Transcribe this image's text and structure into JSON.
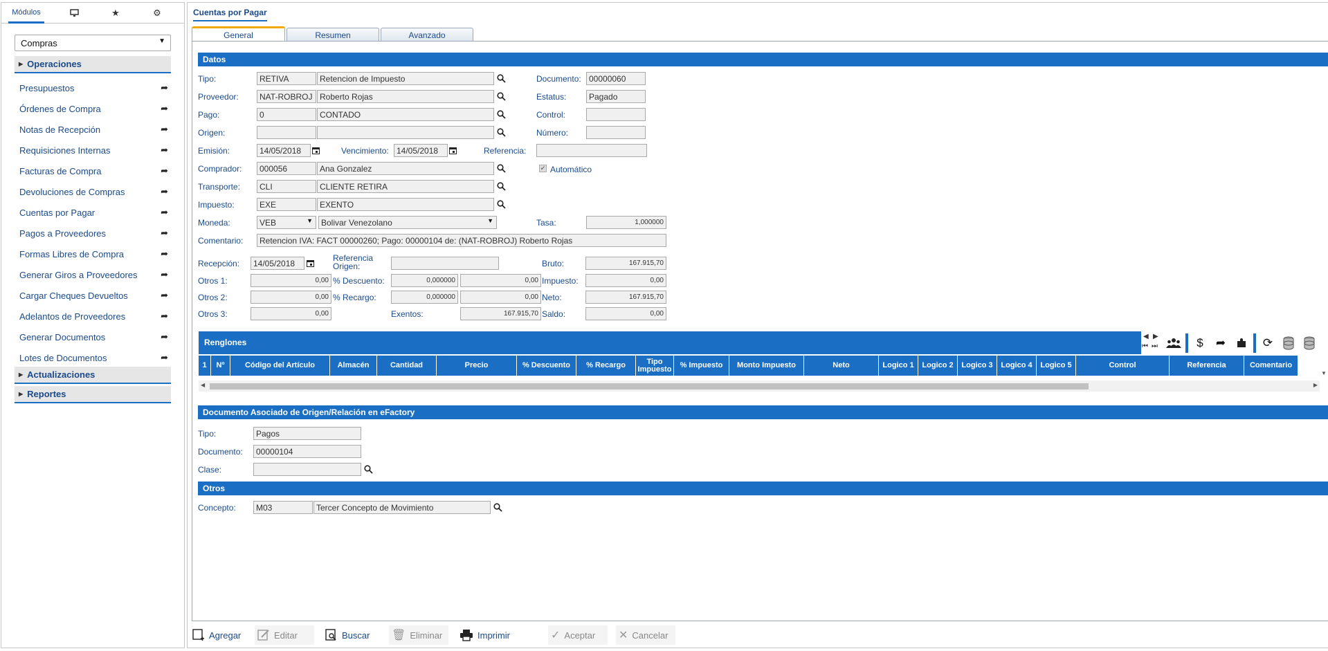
{
  "left_panel": {
    "tabs": {
      "modules_label": "Módulos"
    },
    "module_select": "Compras",
    "groups": {
      "operaciones": "Operaciones",
      "actualizaciones": "Actualizaciones",
      "reportes": "Reportes"
    },
    "items": [
      "Presupuestos",
      "Órdenes de Compra",
      "Notas de Recepción",
      "Requisiciones Internas",
      "Facturas de Compra",
      "Devoluciones de Compras",
      "Cuentas por Pagar",
      "Pagos a Proveedores",
      "Formas Libres de Compra",
      "Generar Giros a Proveedores",
      "Cargar Cheques Devueltos",
      "Adelantos de Proveedores",
      "Generar Documentos",
      "Lotes de Documentos"
    ]
  },
  "main": {
    "title": "Cuentas por Pagar",
    "tabs": [
      "General",
      "Resumen",
      "Avanzado"
    ],
    "sections": {
      "datos": "Datos",
      "renglones": "Renglones",
      "doc_asociado": "Documento Asociado de Origen/Relación en eFactory",
      "otros": "Otros"
    },
    "labels": {
      "tipo": "Tipo:",
      "proveedor": "Proveedor:",
      "pago": "Pago:",
      "origen": "Origen:",
      "emision": "Emisión:",
      "vencimiento": "Vencimiento:",
      "referencia": "Referencia:",
      "comprador": "Comprador:",
      "transporte": "Transporte:",
      "impuesto": "Impuesto:",
      "moneda": "Moneda:",
      "tasa": "Tasa:",
      "comentario": "Comentario:",
      "documento": "Documento:",
      "estatus": "Estatus:",
      "control": "Control:",
      "numero": "Número:",
      "automatico": "Automático",
      "recepcion": "Recepción:",
      "referencia_origen": "Referencia Origen:",
      "otros1": "Otros 1:",
      "otros2": "Otros 2:",
      "otros3": "Otros 3:",
      "descuento": "% Descuento:",
      "recargo": "% Recargo:",
      "exentos": "Exentos:",
      "bruto": "Bruto:",
      "impuesto_r": "Impuesto:",
      "neto": "Neto:",
      "saldo": "Saldo:",
      "clase": "Clase:",
      "concepto": "Concepto:"
    },
    "values": {
      "tipo_code": "RETIVA",
      "tipo_desc": "Retencion de Impuesto",
      "proveedor_code": "NAT-ROBROJ",
      "proveedor_desc": "Roberto Rojas",
      "pago_code": "0",
      "pago_desc": "CONTADO",
      "origen_code": "",
      "origen_desc": "",
      "emision": "14/05/2018",
      "vencimiento": "14/05/2018",
      "referencia": "",
      "comprador_code": "000056",
      "comprador_desc": "Ana Gonzalez",
      "transporte_code": "CLI",
      "transporte_desc": "CLIENTE RETIRA",
      "impuesto_code": "EXE",
      "impuesto_desc": "EXENTO",
      "moneda_code": "VEB",
      "moneda_desc": "Bolivar Venezolano",
      "tasa": "1,000000",
      "comentario": "Retencion IVA: FACT 00000260; Pago: 00000104 de: (NAT-ROBROJ) Roberto Rojas",
      "documento": "00000060",
      "estatus": "Pagado",
      "control": "",
      "numero": "",
      "recepcion": "14/05/2018",
      "referencia_origen": "",
      "otros1": "0,00",
      "otros2": "0,00",
      "otros3": "0,00",
      "descuento_pct": "0,000000",
      "descuento_monto": "0,00",
      "recargo_pct": "0,000000",
      "recargo_monto": "0,00",
      "exentos": "167.915,70",
      "bruto": "167.915,70",
      "impuesto_r": "0,00",
      "neto": "167.915,70",
      "saldo": "0,00"
    },
    "grid_columns": [
      "1",
      "Nº",
      "Código del Artículo",
      "Almacén",
      "Cantidad",
      "Precio",
      "% Descuento",
      "% Recargo",
      "Tipo Impuesto",
      "% Impuesto",
      "Monto Impuesto",
      "Neto",
      "Logico 1",
      "Logico 2",
      "Logico 3",
      "Logico 4",
      "Logico 5",
      "Control",
      "Referencia",
      "Comentario"
    ],
    "doc_asociado": {
      "tipo": "Pagos",
      "documento": "00000104",
      "clase": ""
    },
    "otros": {
      "concepto_code": "M03",
      "concepto_desc": "Tercer Concepto de Movimiento"
    }
  },
  "bottom_toolbar": {
    "agregar": "Agregar",
    "editar": "Editar",
    "buscar": "Buscar",
    "eliminar": "Eliminar",
    "imprimir": "Imprimir",
    "aceptar": "Aceptar",
    "cancelar": "Cancelar"
  },
  "colors": {
    "accent": "#1a6fc4",
    "link": "#1a4a8a",
    "tab_highlight": "#f0a700"
  },
  "icons": [
    "monitor-icon",
    "star-icon",
    "gears-icon",
    "search-icon",
    "calendar-icon",
    "share-arrow-icon",
    "users-icon",
    "dollar-icon",
    "puzzle-icon",
    "refresh-icon",
    "database-icon",
    "print-icon",
    "check-icon",
    "close-icon",
    "trash-icon",
    "edit-icon",
    "add-icon"
  ]
}
